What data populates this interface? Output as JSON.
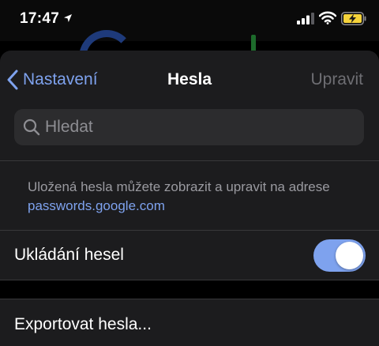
{
  "status": {
    "time": "17:47",
    "icons": [
      "location-arrow-icon",
      "signal-icon",
      "wifi-icon",
      "battery-charging-icon"
    ]
  },
  "nav": {
    "back_label": "Nastavení",
    "title": "Hesla",
    "edit_label": "Upravit"
  },
  "search": {
    "placeholder": "Hledat"
  },
  "info": {
    "text": "Uložená hesla můžete zobrazit a upravit na adrese",
    "link": "passwords.google.com"
  },
  "settings": {
    "save_passwords_label": "Ukládání hesel",
    "save_passwords_on": true,
    "export_label": "Exportovat hesla..."
  },
  "colors": {
    "accent": "#7ea2ee",
    "sheet": "#1c1c1e",
    "search_field": "#2c2c2e",
    "disabled": "#6e6e73",
    "battery_charge": "#f5d33b"
  }
}
